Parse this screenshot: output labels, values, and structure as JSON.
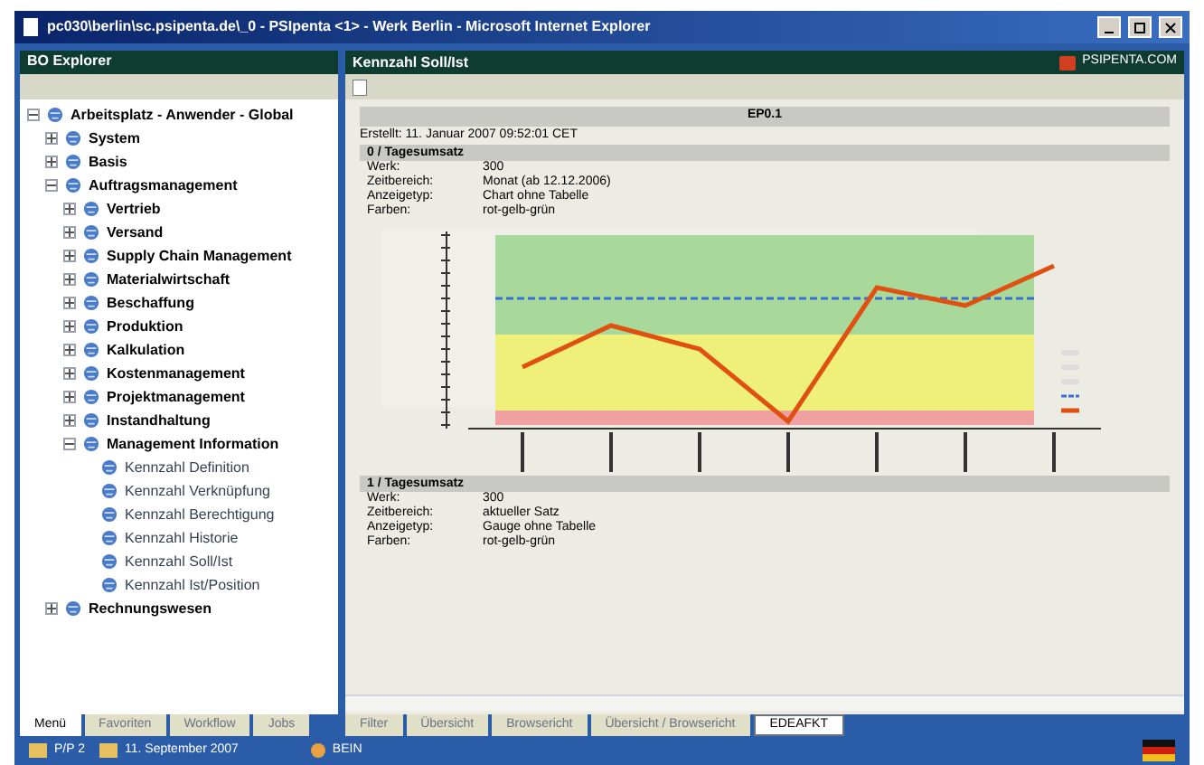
{
  "window": {
    "title": "pc030\\berlin\\sc.psipenta.de\\_0 - PSIpenta <1> - Werk Berlin - Microsoft Internet Explorer"
  },
  "explorer": {
    "title": "BO Explorer",
    "tree": [
      {
        "label": "Arbeitsplatz - Anwender - Global",
        "expanded": true,
        "children": [
          {
            "label": "System",
            "expanded": false
          },
          {
            "label": "Basis",
            "expanded": false
          },
          {
            "label": "Auftragsmanagement",
            "expanded": true,
            "children": [
              {
                "label": "Vertrieb",
                "expanded": false
              },
              {
                "label": "Versand",
                "expanded": false
              },
              {
                "label": "Supply Chain Management",
                "expanded": false
              },
              {
                "label": "Materialwirtschaft",
                "expanded": false
              },
              {
                "label": "Beschaffung",
                "expanded": false
              },
              {
                "label": "Produktion",
                "expanded": false
              },
              {
                "label": "Kalkulation",
                "expanded": false
              },
              {
                "label": "Kostenmanagement",
                "expanded": false
              },
              {
                "label": "Projektmanagement",
                "expanded": false
              },
              {
                "label": "Instandhaltung",
                "expanded": false
              },
              {
                "label": "Management Information",
                "expanded": true,
                "children": [
                  {
                    "label": "Kennzahl Definition"
                  },
                  {
                    "label": "Kennzahl Verknüpfung"
                  },
                  {
                    "label": "Kennzahl Berechtigung"
                  },
                  {
                    "label": "Kennzahl Historie"
                  },
                  {
                    "label": "Kennzahl Soll/Ist"
                  },
                  {
                    "label": "Kennzahl Ist/Position"
                  }
                ]
              }
            ]
          },
          {
            "label": "Rechnungswesen",
            "expanded": false
          }
        ]
      }
    ],
    "tabs": [
      {
        "label": "Menü",
        "selected": true
      },
      {
        "label": "Favoriten",
        "selected": false
      },
      {
        "label": "Workflow",
        "selected": false
      },
      {
        "label": "Jobs",
        "selected": false
      }
    ]
  },
  "content": {
    "title": "Kennzahl Soll/Ist",
    "brand": "PSIPENTA.COM",
    "report_title": "EP0.1",
    "created": "Erstellt: 11. Januar 2007 09:52:01 CET",
    "sections": [
      {
        "heading": "0 / Tagesumsatz",
        "fields": [
          [
            "Werk:",
            "300"
          ],
          [
            "Zeitbereich:",
            "Monat (ab 12.12.2006)"
          ],
          [
            "Anzeigetyp:",
            "Chart ohne Tabelle"
          ],
          [
            "Farben:",
            "rot-gelb-grün"
          ]
        ]
      },
      {
        "heading": "1 / Tagesumsatz",
        "fields": [
          [
            "Werk:",
            "300"
          ],
          [
            "Zeitbereich:",
            "aktueller Satz"
          ],
          [
            "Anzeigetyp:",
            "Gauge ohne Tabelle"
          ],
          [
            "Farben:",
            "rot-gelb-grün"
          ]
        ]
      }
    ],
    "tabs": [
      {
        "label": "Filter",
        "selected": false
      },
      {
        "label": "Übersicht",
        "selected": false
      },
      {
        "label": "Browsericht",
        "selected": false
      },
      {
        "label": "Übersicht / Browsericht",
        "selected": false
      },
      {
        "label": "EDEAFKT",
        "selected": true
      }
    ]
  },
  "taskbar": {
    "items": [
      "P/P 2",
      "11. September 2007"
    ],
    "start": "BEIN"
  }
}
